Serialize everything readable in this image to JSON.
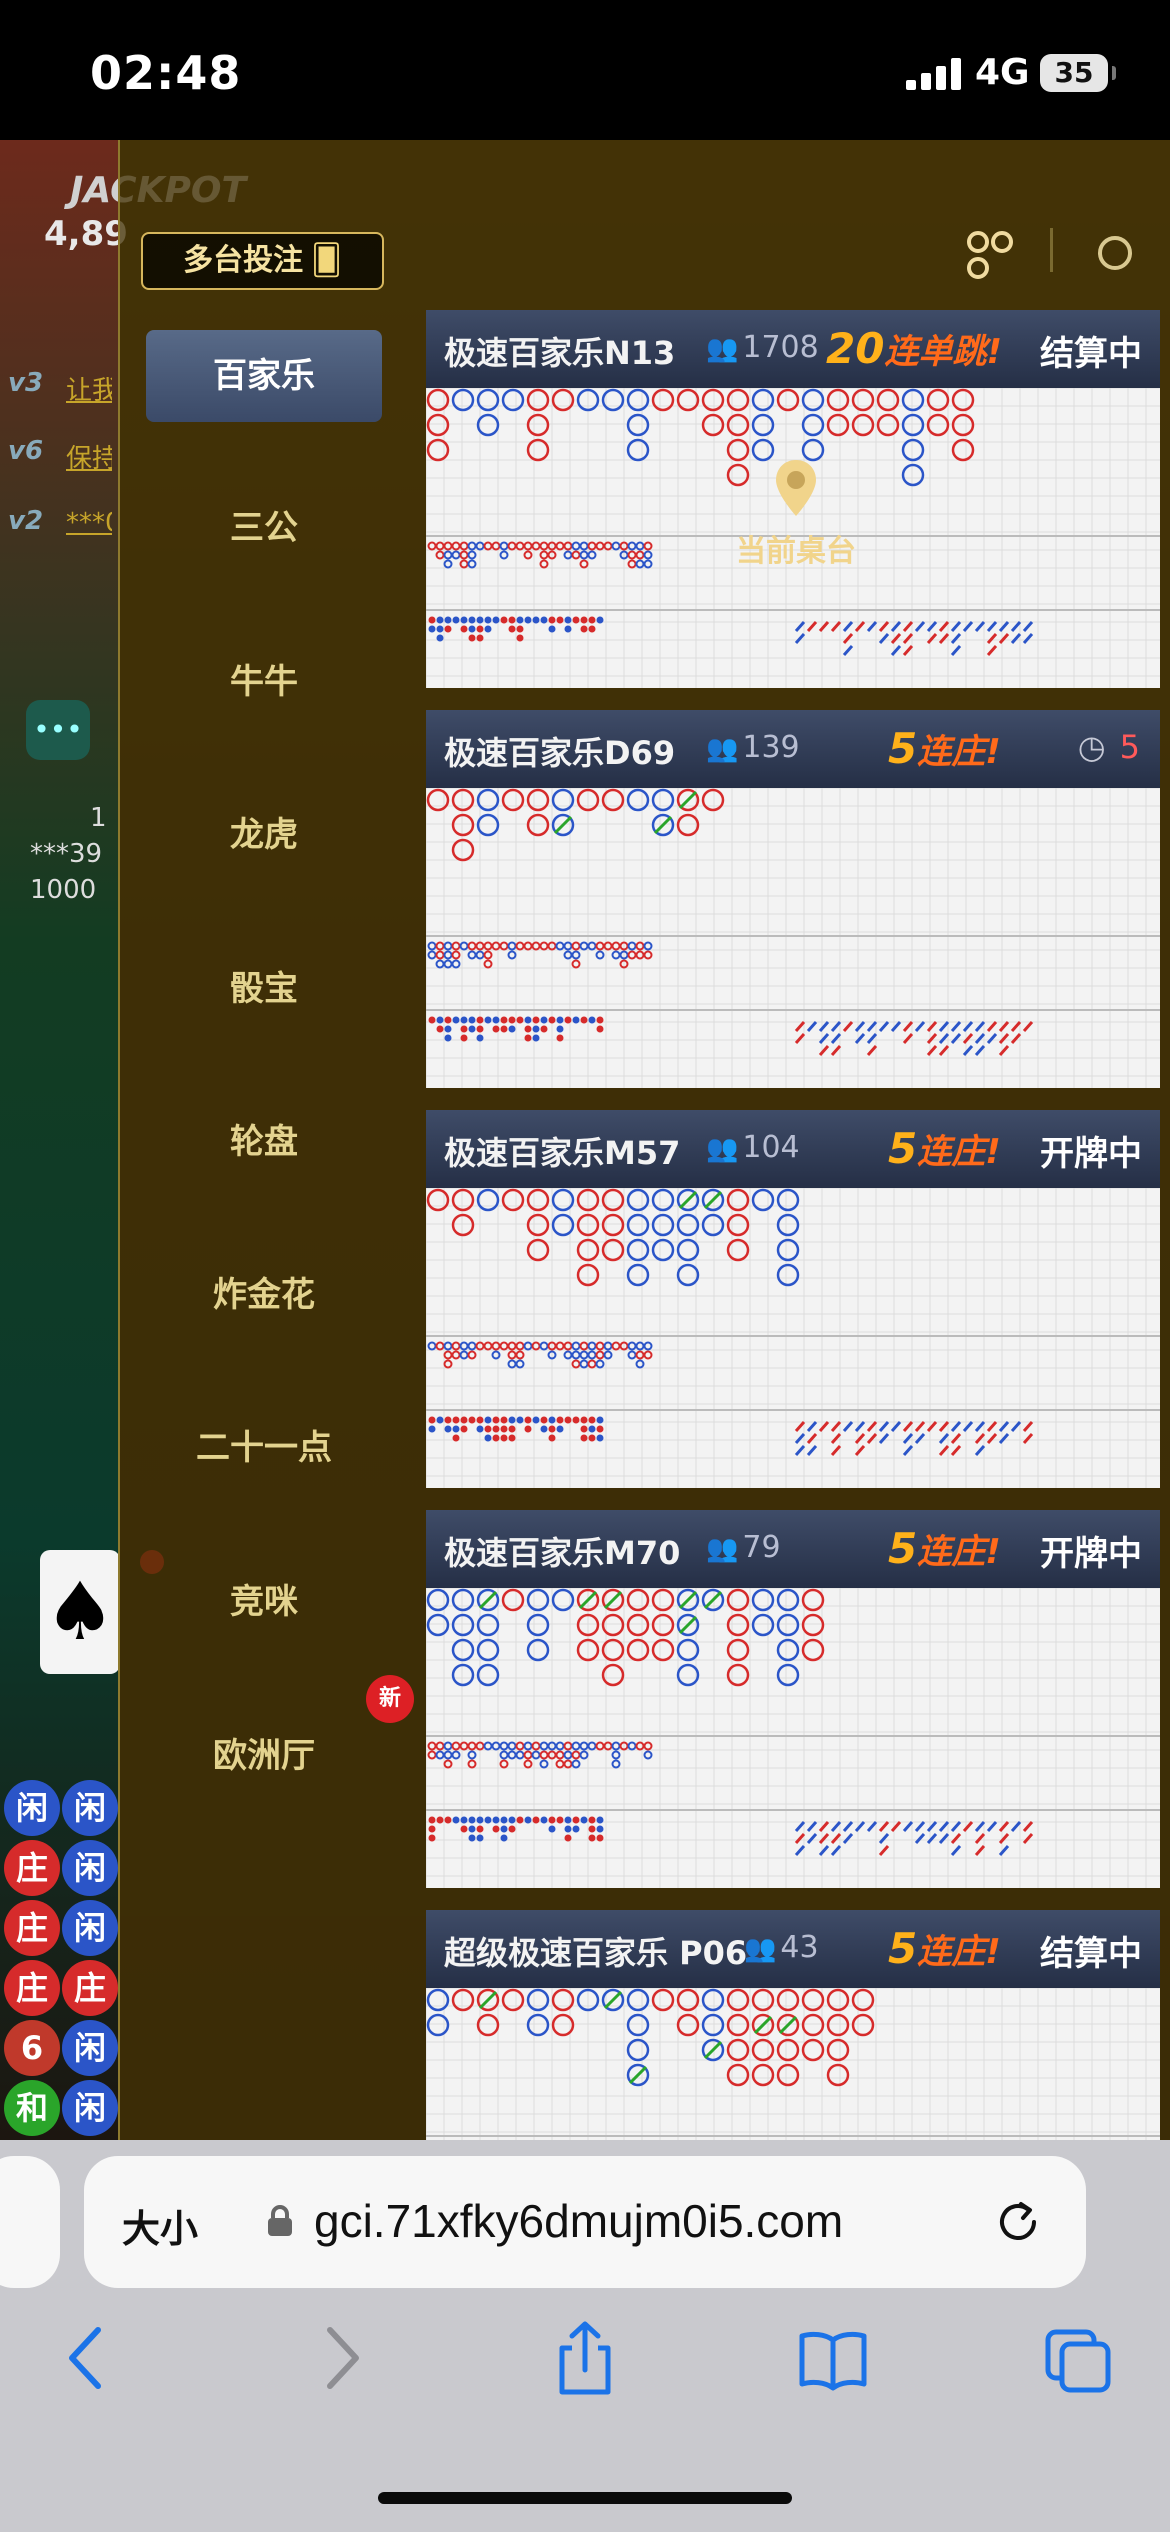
{
  "status_bar": {
    "time": "02:48",
    "network": "4G",
    "battery": "35"
  },
  "background": {
    "jackpot_label": "JACKPOT",
    "jackpot_amount": "4,89",
    "chat": [
      {
        "level": "v3",
        "text": "让我"
      },
      {
        "level": "v6",
        "text": "保持"
      },
      {
        "level": "v2",
        "text": "***0"
      }
    ],
    "seat": {
      "rank": "1",
      "name": "***39",
      "amount": "1000"
    },
    "road_labels": [
      "闲",
      "闲",
      "庄",
      "闲",
      "庄",
      "闲",
      "庄",
      "庄",
      "6",
      "闲",
      "和",
      "闲"
    ]
  },
  "header": {
    "multi_bet_label": "多台投注"
  },
  "nav": {
    "items": [
      {
        "label": "百家乐",
        "active": true
      },
      {
        "label": "三公"
      },
      {
        "label": "牛牛"
      },
      {
        "label": "龙虎"
      },
      {
        "label": "骰宝"
      },
      {
        "label": "轮盘"
      },
      {
        "label": "炸金花"
      },
      {
        "label": "二十一点"
      },
      {
        "label": "竞咪"
      },
      {
        "label": "欧洲厅"
      }
    ],
    "new_badge": "新"
  },
  "current_table_label": "当前桌台",
  "tables": [
    {
      "title": "极速百家乐N13",
      "players": "1708",
      "streak_num": "20",
      "streak_text": "连单跳!",
      "status": "结算中"
    },
    {
      "title": "极速百家乐D69",
      "players": "139",
      "streak_num": "5",
      "streak_text": "连庄!",
      "countdown": "5"
    },
    {
      "title": "极速百家乐M57",
      "players": "104",
      "streak_num": "5",
      "streak_text": "连庄!",
      "status": "开牌中"
    },
    {
      "title": "极速百家乐M70",
      "players": "79",
      "streak_num": "5",
      "streak_text": "连庄!",
      "status": "开牌中"
    },
    {
      "title": "超级极速百家乐 P06",
      "players": "43",
      "streak_num": "5",
      "streak_text": "连庄!",
      "status": "结算中"
    }
  ],
  "browser": {
    "text_size_label": "大小",
    "url": "gci.71xfky6dmujm0i5.com"
  },
  "colors": {
    "banker": "#d62b2b",
    "player": "#2b55c8",
    "tie": "#2aa52a",
    "gold": "#d7b75d"
  }
}
